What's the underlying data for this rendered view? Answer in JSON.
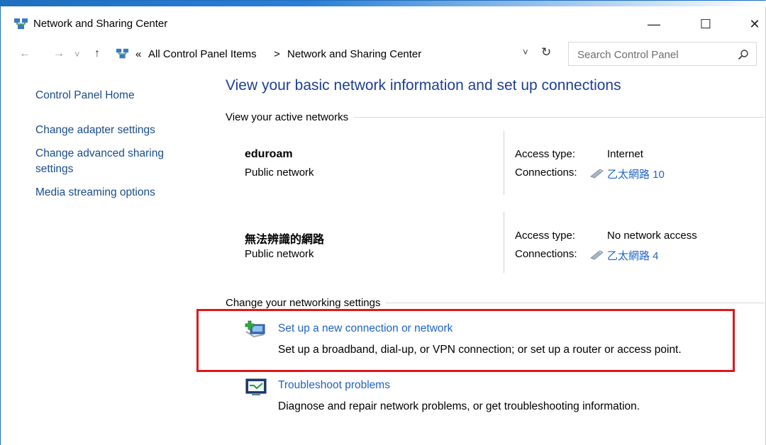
{
  "window": {
    "title": "Network and Sharing Center",
    "controls": {
      "minimize": "—",
      "maximize": "☐",
      "close": "✕"
    }
  },
  "address": {
    "back": "←",
    "forward": "→",
    "recent": "˅",
    "up": "↑",
    "overflow": "«",
    "crumbs": [
      "All Control Panel Items",
      "Network and Sharing Center"
    ],
    "separator": ">",
    "dropdown": "˅",
    "refresh": "↻",
    "search_placeholder": "Search Control Panel"
  },
  "sidebar": {
    "items": [
      {
        "label": "Control Panel Home"
      },
      {
        "label": "Change adapter settings"
      },
      {
        "label": "Change advanced sharing\nsettings"
      },
      {
        "label": "Media streaming options"
      }
    ]
  },
  "main": {
    "headline": "View your basic network information and set up connections",
    "active_networks_title": "View your active networks",
    "networks": [
      {
        "name": "eduroam",
        "category": "Public network",
        "access_label": "Access type:",
        "access_value": "Internet",
        "conn_label": "Connections:",
        "conn_value": "乙太網路 10"
      },
      {
        "name": "無法辨識的網路",
        "category": "Public network",
        "access_label": "Access type:",
        "access_value": "No network access",
        "conn_label": "Connections:",
        "conn_value": "乙太網路 4"
      }
    ],
    "change_settings_title": "Change your networking settings",
    "tasks": [
      {
        "link": "Set up a new connection or network",
        "desc": "Set up a broadband, dial-up, or VPN connection; or set up a router or access point."
      },
      {
        "link": "Troubleshoot problems",
        "desc": "Diagnose and repair network problems, or get troubleshooting information."
      }
    ]
  },
  "colors": {
    "link": "#1e63c7",
    "headline": "#1e3f91",
    "highlight_box": "#e0161a"
  }
}
